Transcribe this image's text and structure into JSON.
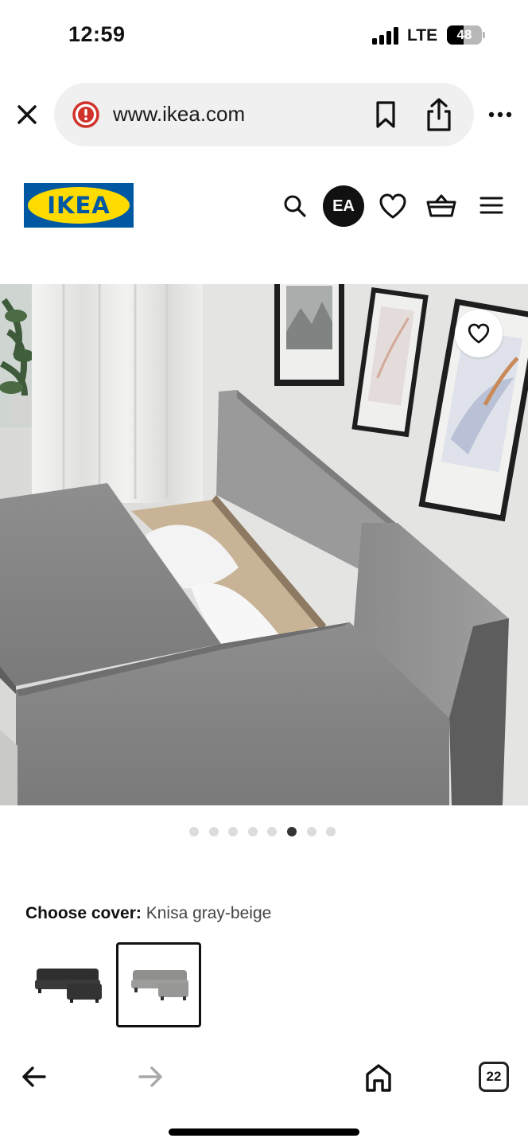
{
  "status_bar": {
    "time": "12:59",
    "network": "LTE",
    "battery": "48",
    "battery_level_percent": 48
  },
  "browser": {
    "url": "www.ikea.com",
    "icons": {
      "close": "close-icon",
      "security": "security-warning-icon",
      "bookmark": "bookmark-icon",
      "share": "share-icon",
      "more": "more-icon"
    }
  },
  "header": {
    "logo_text": "IKEA",
    "avatar_initials": "EA",
    "icons": [
      "search-icon",
      "wishlist-heart-icon",
      "shopping-basket-icon",
      "hamburger-menu-icon"
    ]
  },
  "gallery": {
    "image": "gray sofa bed with open storage compartment in living room",
    "dot_count": 8,
    "active_dot_index": 5
  },
  "cover": {
    "label": "Choose cover:",
    "value": "Knisa gray-beige",
    "options": [
      {
        "name": "dark gray cover swatch",
        "selected": false
      },
      {
        "name": "gray-beige cover swatch",
        "selected": true
      }
    ]
  },
  "toolbar": {
    "tabs_count": "22",
    "icons": [
      "back-arrow-icon",
      "forward-arrow-icon",
      "home-icon",
      "tabs-icon"
    ]
  },
  "colors": {
    "ikea_blue": "#0058a3",
    "ikea_yellow": "#ffdb00",
    "security_red": "#d0332b",
    "pill_bg": "#f0f0f0"
  }
}
